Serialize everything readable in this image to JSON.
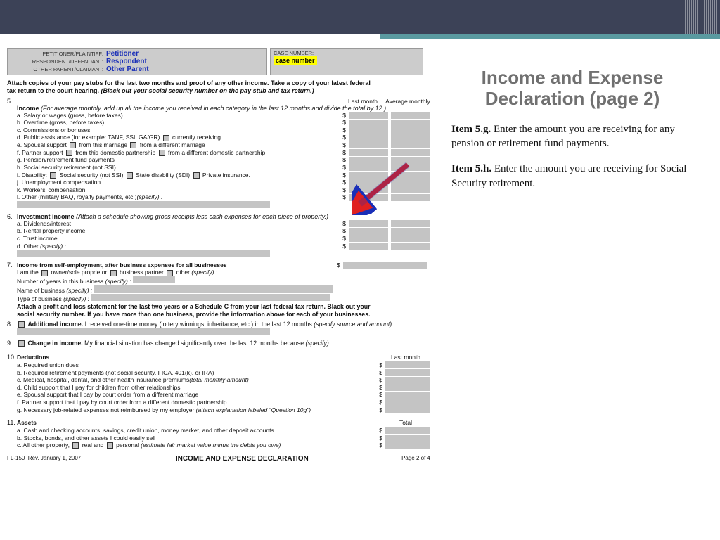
{
  "header": {
    "petitioner_lbl": "PETITIONER/PLAINTIFF:",
    "petitioner_val": "Petitioner",
    "respondent_lbl": "RESPONDENT/DEFENDANT:",
    "respondent_val": "Respondent",
    "other_lbl": "OTHER PARENT/CLAIMANT:",
    "other_val": "Other Parent",
    "casenum_lbl": "CASE NUMBER:",
    "casenum_val": "case number",
    "formcode": "FL-150"
  },
  "attach": {
    "line1": "Attach copies of your pay stubs for the last two months and proof of any other income. Take a copy of your latest federal",
    "line2a": "tax return to the court hearing. ",
    "line2b": "(Black out your social security number on the pay stub and tax return.)"
  },
  "cols": {
    "lm": "Last month",
    "am": "Average monthly"
  },
  "s5": {
    "num": "5.",
    "head": "Income ",
    "headital": "(For average monthly, add up all the income you received in each category in the last 12 months and divide the total by 12.)",
    "a": "a.  Salary or wages (gross, before taxes)",
    "b": "b.  Overtime (gross, before taxes)",
    "c": "c.  Commissions or bonuses",
    "d1": "d.  Public assistance (for example: TANF, SSI, GA/GR) ",
    "d2": " currently receiving",
    "e1": "e.  Spousal support ",
    "e2": " from this marriage  ",
    "e3": " from a different marriage",
    "f1": "f.   Partner support ",
    "f2": " from this domestic partnership  ",
    "f3": " from a different domestic partnership",
    "g": "g.  Pension/retirement fund payments",
    "h": "h.  Social security retirement (not SSI)",
    "i1": "i.   Disability:   ",
    "i2": " Social security (not SSI)  ",
    "i3": " State disability (SDI)  ",
    "i4": " Private insurance.",
    "j": "j.   Unemployment compensation",
    "k": "k.  Workers' compensation",
    "l1": "l.   Other (military BAQ, royalty payments, etc.)",
    "l2": "(specify) :"
  },
  "s6": {
    "num": "6.",
    "head": "Investment income ",
    "headital": "(Attach a schedule showing gross receipts less cash expenses for each piece of property.)",
    "a": "a.  Dividends/interest",
    "b": "b.  Rental property income",
    "c": "c.  Trust income",
    "d1": "d.  Other ",
    "d2": "(specify) :"
  },
  "s7": {
    "num": "7.",
    "head": "Income from self-employment, after business expenses for all businesses",
    "iam": "I am the  ",
    "op1": " owner/sole proprietor     ",
    "op2": " business partner  ",
    "op3": " other ",
    "spec": "(specify) :",
    "years": "Number of years in this business ",
    "yearsital": "(specify) :",
    "name": "Name of business ",
    "nameital": "(specify) :",
    "type": "Type of business ",
    "typeital": "(specify) :",
    "att1": "Attach a profit and loss statement for the last two years or a Schedule C from your last federal tax return. Black out your",
    "att2": "social security number. If you have more than one business, provide the information above for each of your businesses."
  },
  "s8": {
    "num": "8.",
    "head": "Additional income.",
    "body": " I received one-time money (lottery winnings, inheritance, etc.) in the last 12 months ",
    "ital": "(specify source and amount) :"
  },
  "s9": {
    "num": "9.",
    "head": "Change in income.",
    "body": " My financial situation has changed significantly over the last 12 months because ",
    "ital": "(specify) :"
  },
  "s10": {
    "num": "10.",
    "head": "Deductions",
    "col": "Last month",
    "a": "a.   Required union dues",
    "b": "b.   Required retirement payments (not social security, FICA, 401(k), or IRA)",
    "c1": "c.   Medical, hospital, dental, and other health insurance premiums",
    "c2": "(total monthly amount)",
    "d": "d.   Child support that I pay for children from other relationships",
    "e": "e.   Spousal support that I pay by court order from a different marriage",
    "f": "f.    Partner support that I pay by court order from a different domestic partnership",
    "g1": "g.   Necessary job-related expenses not reimbursed by my employer ",
    "g2": "(attach explanation labeled \"Question 10g\")"
  },
  "s11": {
    "num": "11.",
    "head": "Assets",
    "col": "Total",
    "a": "a.   Cash and checking accounts, savings, credit union, money market, and other deposit accounts",
    "b": "b.   Stocks, bonds, and other assets I could easily sell",
    "c1": "c.   All other property,   ",
    "c2": " real and  ",
    "c3": " personal ",
    "c4": "(estimate fair market value minus the debts you owe)"
  },
  "footer": {
    "left": "FL-150 [Rev. January 1, 2007]",
    "title": "INCOME AND EXPENSE DECLARATION",
    "right": "Page 2 of 4"
  },
  "side": {
    "title": "Income and Expense Declaration (page 2)",
    "p1b": "Item 5.g.",
    "p1": "  Enter the amount you are receiving for any pension or retirement fund payments.",
    "p2b": "Item 5.h.",
    "p2": "  Enter the amount you are receiving for Social Security retirement."
  }
}
